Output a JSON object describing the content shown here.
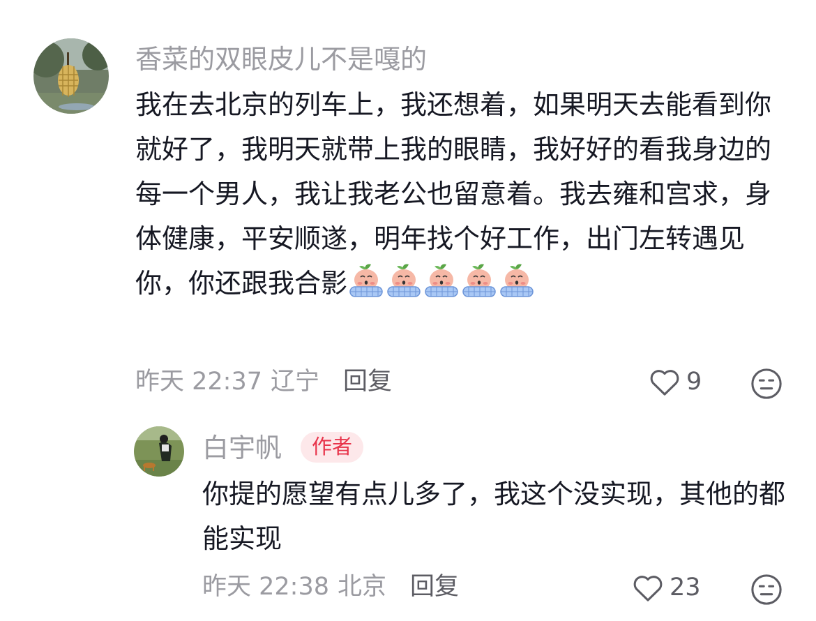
{
  "comment": {
    "username": "香菜的双眼皮儿不是嘎的",
    "text": "我在去北京的列车上，我还想着，如果明天去能看到你就好了，我明天就带上我的眼睛，我好好的看我身边的每一个男人，我让我老公也留意着。我去雍和宫求，身体健康，平安顺遂，明年找个好工作，出门左转遇见你，你还跟我合影",
    "emoji_count": 5,
    "emoji_icon": "crying-peach-sticker",
    "time": "昨天 22:37",
    "location": "辽宁",
    "reply_label": "回复",
    "like_count": "9"
  },
  "reply": {
    "username": "白宇帆",
    "badge": "作者",
    "text": "你提的愿望有点儿多了，我这个没实现，其他的都能实现",
    "time": "昨天 22:38",
    "location": "北京",
    "reply_label": "回复",
    "like_count": "23"
  },
  "colors": {
    "text_primary": "#161823",
    "text_secondary": "#9b9ba1",
    "action": "#5c5c63",
    "badge_bg": "#fde8ea",
    "badge_text": "#e8344b"
  }
}
